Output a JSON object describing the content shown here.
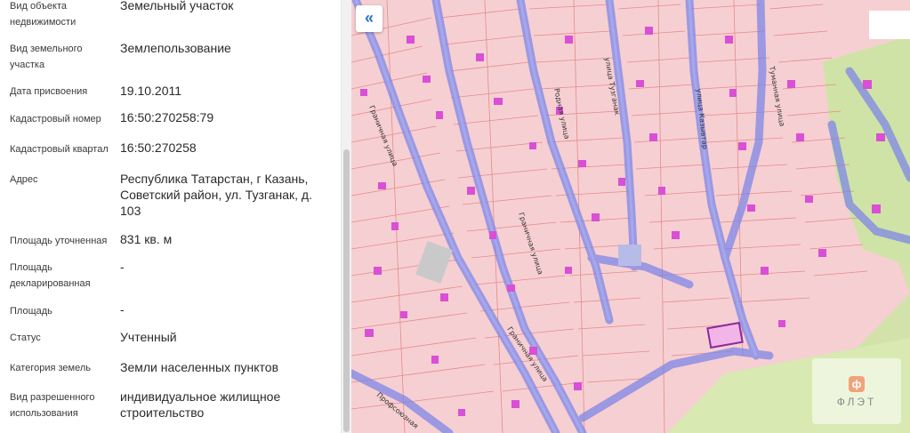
{
  "info_panel": {
    "rows": [
      {
        "label": "Вид объекта недвижимости",
        "value": "Земельный участок"
      },
      {
        "label": "Вид земельного участка",
        "value": "Землепользование"
      },
      {
        "label": "Дата присвоения",
        "value": "19.10.2011"
      },
      {
        "label": "Кадастровый номер",
        "value": "16:50:270258:79"
      },
      {
        "label": "Кадастровый квартал",
        "value": "16:50:270258"
      },
      {
        "label": "Адрес",
        "value": "Республика Татарстан, г Казань, Советский район, ул. Тузганак, д. 103"
      },
      {
        "label": "Площадь уточненная",
        "value": "831 кв. м"
      },
      {
        "label": "Площадь декларированная",
        "value": "-"
      },
      {
        "label": "Площадь",
        "value": "-"
      },
      {
        "label": "Статус",
        "value": "Учтенный"
      },
      {
        "label": "Категория земель",
        "value": "Земли населенных пунктов"
      },
      {
        "label": "Вид разрешенного использования",
        "value": "индивидуальное жилищное строительство"
      }
    ]
  },
  "map": {
    "collapse_icon": "«",
    "streets": {
      "granichnaya_1": "Граничная улица",
      "granichnaya_2": "Граничная улица",
      "granichnaya_3": "Граничная улица",
      "rodnaya": "Родная улица",
      "tuzganak": "улица Тузганак",
      "kazyvtar": "улица Казывтар",
      "tumannaya": "Туманная улица",
      "profsoyuznaya": "Профсоюзная"
    },
    "colors": {
      "parcel_fill": "#f6cfd2",
      "road": "#7f86e6",
      "building": "#d94fd6",
      "green": "#cfe3a6"
    }
  },
  "logo": {
    "mark": "ф",
    "text": "ФЛЭТ"
  }
}
